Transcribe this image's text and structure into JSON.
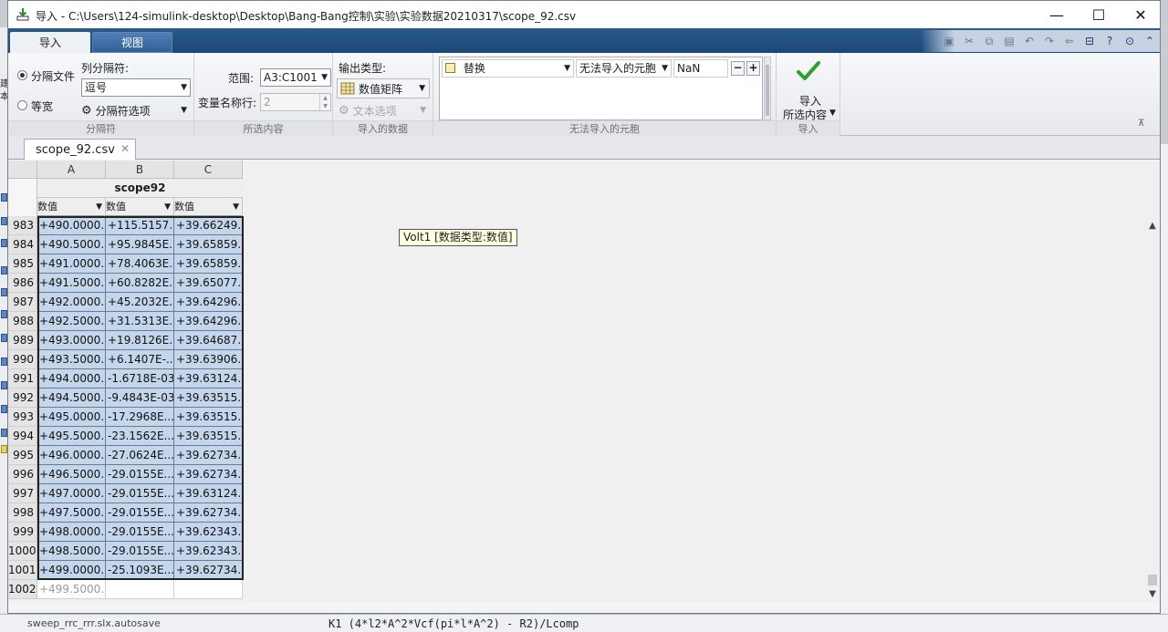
{
  "window": {
    "title": "导入 - C:\\Users\\124-simulink-desktop\\Desktop\\Bang-Bang控制\\实验\\实验数据20210317\\scope_92.csv",
    "minimize": "—",
    "maximize": "☐",
    "close": "✕"
  },
  "ribbon_tabs": [
    "导入",
    "视图"
  ],
  "delimiter_group": {
    "label": "分隔符",
    "option_delimited": "分隔文件",
    "option_fixed": "等宽",
    "column_delimiter_label": "列分隔符:",
    "column_delimiter_value": "逗号",
    "delimiter_options": "分隔符选项"
  },
  "selection_group": {
    "label": "所选内容",
    "range_label": "范围:",
    "range_value": "A3:C1001",
    "varname_row_label": "变量名称行:",
    "varname_row_value": "2"
  },
  "imported_data_group": {
    "label": "导入的数据",
    "output_type_label": "输出类型:",
    "output_type_value": "数值矩阵",
    "text_options": "文本选项"
  },
  "unimportable_group": {
    "label": "无法导入的元胞",
    "rule_action": "替换",
    "rule_target": "无法导入的元胞",
    "rule_value": "NaN",
    "minus": "−",
    "plus": "+"
  },
  "import_group": {
    "label": "导入",
    "button_line1": "导入",
    "button_line2": "所选内容"
  },
  "file_tab": {
    "name": "scope_92.csv",
    "close": "✕"
  },
  "sheet": {
    "columns": [
      "A",
      "B",
      "C"
    ],
    "variable_name": "scope92",
    "column_types": [
      "数值",
      "数值",
      "数值"
    ],
    "rows": [
      {
        "n": "983",
        "a": "+490.0000...",
        "b": "+115.5157...",
        "c": "+39.66249..."
      },
      {
        "n": "984",
        "a": "+490.5000...",
        "b": "+95.9845E...",
        "c": "+39.65859..."
      },
      {
        "n": "985",
        "a": "+491.0000...",
        "b": "+78.4063E...",
        "c": "+39.65859..."
      },
      {
        "n": "986",
        "a": "+491.5000...",
        "b": "+60.8282E...",
        "c": "+39.65077..."
      },
      {
        "n": "987",
        "a": "+492.0000...",
        "b": "+45.2032E...",
        "c": "+39.64296..."
      },
      {
        "n": "988",
        "a": "+492.5000...",
        "b": "+31.5313E...",
        "c": "+39.64296..."
      },
      {
        "n": "989",
        "a": "+493.0000...",
        "b": "+19.8126E...",
        "c": "+39.64687..."
      },
      {
        "n": "990",
        "a": "+493.5000...",
        "b": "+6.1407E-...",
        "c": "+39.63906..."
      },
      {
        "n": "991",
        "a": "+494.0000...",
        "b": "-1.6718E-03",
        "c": "+39.63124..."
      },
      {
        "n": "992",
        "a": "+494.5000...",
        "b": "-9.4843E-03",
        "c": "+39.63515..."
      },
      {
        "n": "993",
        "a": "+495.0000...",
        "b": "-17.2968E...",
        "c": "+39.63515..."
      },
      {
        "n": "994",
        "a": "+495.5000...",
        "b": "-23.1562E...",
        "c": "+39.63515..."
      },
      {
        "n": "995",
        "a": "+496.0000...",
        "b": "-27.0624E...",
        "c": "+39.62734..."
      },
      {
        "n": "996",
        "a": "+496.5000...",
        "b": "-29.0155E...",
        "c": "+39.62734..."
      },
      {
        "n": "997",
        "a": "+497.0000...",
        "b": "-29.0155E...",
        "c": "+39.63124..."
      },
      {
        "n": "998",
        "a": "+497.5000...",
        "b": "-29.0155E...",
        "c": "+39.62734..."
      },
      {
        "n": "999",
        "a": "+498.0000...",
        "b": "-29.0155E...",
        "c": "+39.62343..."
      },
      {
        "n": "1000",
        "a": "+498.5000...",
        "b": "-29.0155E...",
        "c": "+39.62343..."
      },
      {
        "n": "1001",
        "a": "+499.0000...",
        "b": "-25.1093E...",
        "c": "+39.62734..."
      }
    ],
    "excluded_row": {
      "n": "1002",
      "a": "+499.5000...",
      "b": "",
      "c": ""
    },
    "tooltip": "Volt1 [数据类型:数值]"
  },
  "background": {
    "bottom_left_text": "sweep_rrc_rrr.slx.autosave",
    "bottom_code_text": "K1    (4*l2*A^2*Vcf(pi*l*A^2) - R2)/Lcomp",
    "left_char_1": "建",
    "left_char_2": "本"
  },
  "colors": {
    "ribbon_tab_bar": "#1d4676",
    "selected_cell": "#c4d6ec",
    "tooltip_bg": "#ffffe1",
    "import_check": "#2ea02e"
  }
}
